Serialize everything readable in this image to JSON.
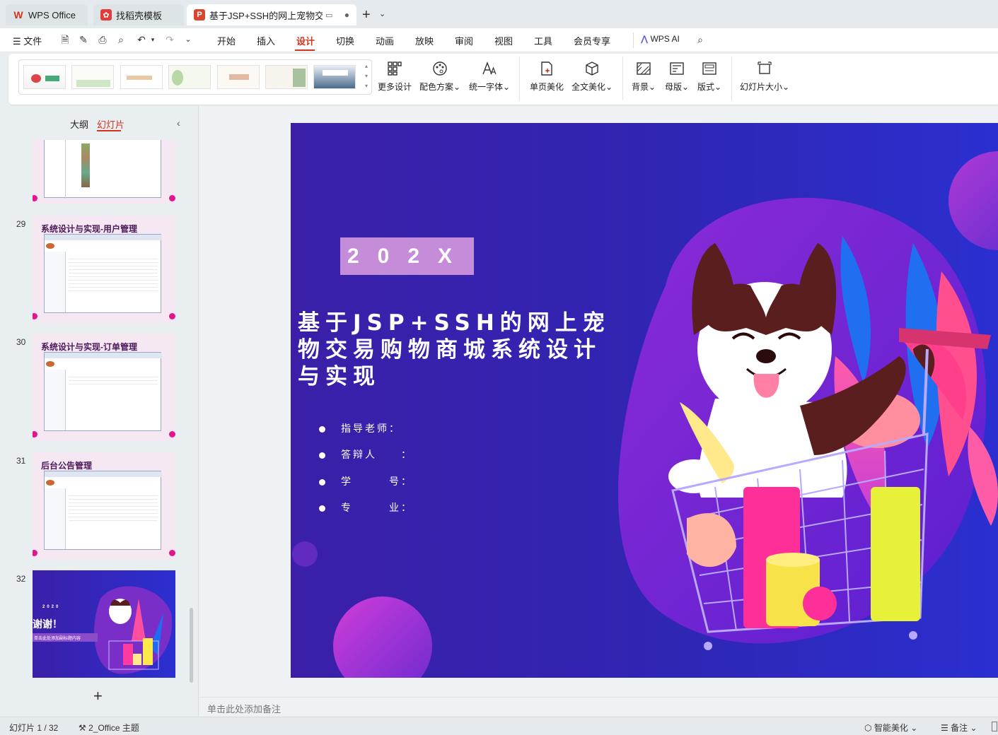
{
  "tabs": [
    {
      "label": "WPS Office"
    },
    {
      "label": "找稻壳模板"
    },
    {
      "label": "基于JSP+SSH的网上宠物交易"
    }
  ],
  "menu": {
    "file": "文件",
    "items": [
      "开始",
      "插入",
      "设计",
      "切换",
      "动画",
      "放映",
      "审阅",
      "视图",
      "工具",
      "会员专享"
    ],
    "active": "设计",
    "wps_ai": "WPS AI"
  },
  "ribbon": {
    "buttons": [
      "更多设计",
      "配色方案",
      "统一字体",
      "单页美化",
      "全文美化",
      "背景",
      "母版",
      "版式",
      "幻灯片大小"
    ]
  },
  "panel": {
    "tab_outline": "大纲",
    "tab_slides": "幻灯片"
  },
  "thumbnails": [
    {
      "num": "29",
      "title": "系统设计与实现-用户管理"
    },
    {
      "num": "30",
      "title": "系统设计与实现-订单管理"
    },
    {
      "num": "31",
      "title": "后台公告管理"
    },
    {
      "num": "32",
      "year": "2020",
      "thanks": "谢谢！",
      "subtitle": "单击此处添加副标题内容"
    }
  ],
  "slide": {
    "year": "202X",
    "title": "基于JSP+SSH的网上宠物交易购物商城系统设计与实现",
    "bullets": [
      "指导老师：",
      "答辩人　　：",
      "学　　　号：",
      "专　　　业："
    ]
  },
  "notes_placeholder": "单击此处添加备注",
  "status": {
    "slide_count": "幻灯片 1 / 32",
    "theme": "2_Office 主题",
    "smart": "智能美化",
    "notes": "备注"
  },
  "colors": {
    "accent": "#d3341f",
    "slide_bg": "#3322b4",
    "year_box": "#c58cd9",
    "thumb_bg": "#f6e8f3"
  }
}
